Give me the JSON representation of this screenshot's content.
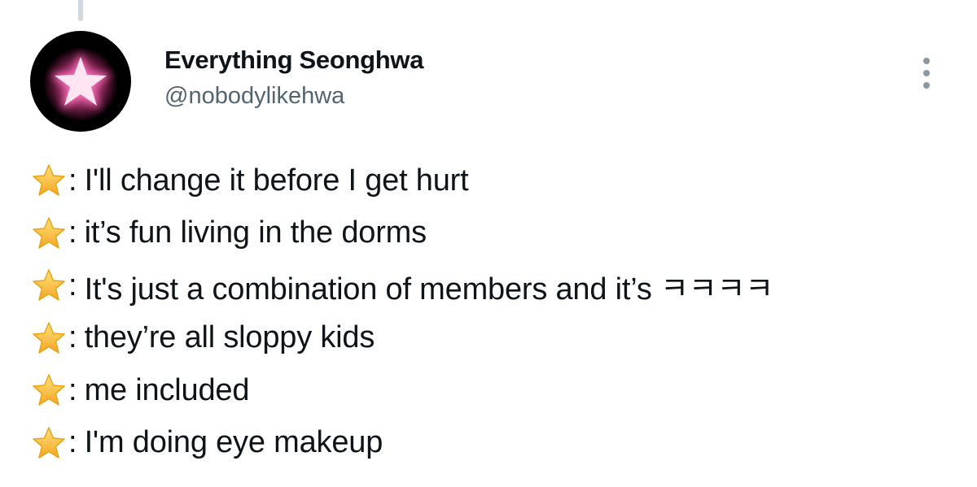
{
  "user": {
    "name": "Everything Seonghwa",
    "handle": "@nobodylikehwa",
    "avatar_icon": "glowing-pink-star-icon"
  },
  "more_icon": "more-options-vertical-dots-icon",
  "line_icon": "star-emoji-icon",
  "separator": ":",
  "tweet_lines": [
    "I'll change it before I get hurt",
    "it’s fun living in the dorms",
    "It's just a combination of members and it’s ㅋㅋㅋㅋ",
    "they’re all sloppy kids",
    "me included",
    "I'm doing eye makeup"
  ],
  "colors": {
    "text": "#0f1419",
    "secondary_text": "#536471",
    "star_fill": "#ffcc33",
    "avatar_star": "#ffe4f1"
  }
}
